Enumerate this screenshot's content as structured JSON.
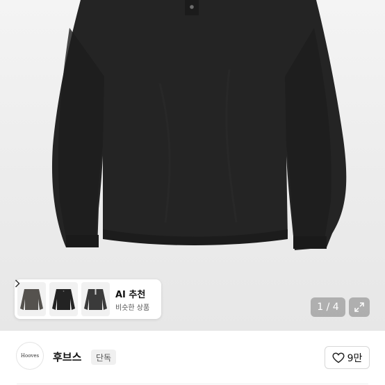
{
  "ai_recommend": {
    "title": "AI 추천",
    "subtitle": "비슷한 상품",
    "thumbnails": [
      {
        "name": "thumb-charcoal-longsleeve",
        "color": "#55524e"
      },
      {
        "name": "thumb-black-henley",
        "color": "#232323"
      },
      {
        "name": "thumb-dark-henley",
        "color": "#3a3a3a"
      }
    ]
  },
  "gallery": {
    "counter": "1 / 4"
  },
  "shop": {
    "logo_text": "Hooves",
    "name": "후브스",
    "badge": "단독"
  },
  "like": {
    "count": "9만"
  },
  "colors": {
    "garment": "#222222",
    "background": "#ececec"
  }
}
